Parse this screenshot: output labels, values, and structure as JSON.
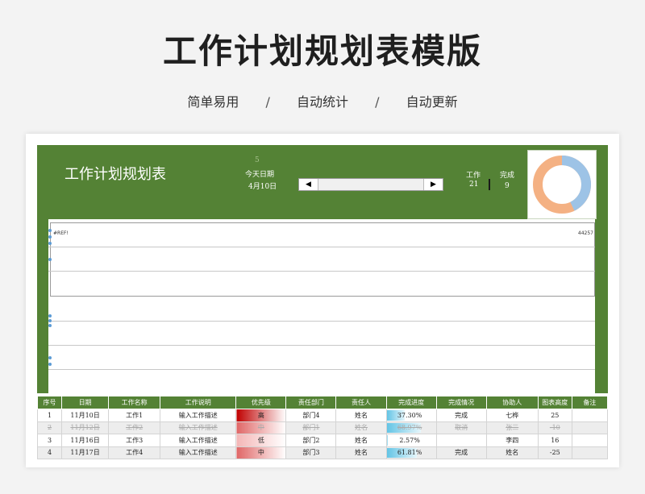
{
  "hero": {
    "title": "工作计划规划表模版",
    "features": [
      "简单易用",
      "自动统计",
      "自动更新"
    ],
    "separator": "/"
  },
  "sheet": {
    "title": "工作计划规划表",
    "small_number": "5",
    "today_label": "今天日期",
    "today_date": "4月10日",
    "stats": {
      "work_label": "工作",
      "work_value": "21",
      "done_label": "完成",
      "done_value": "9"
    },
    "scroll": {
      "left_arrow": "◀",
      "right_arrow": "▶"
    },
    "donut": {
      "completed": 9,
      "total": 21,
      "colors": {
        "done": "#9dc3e6",
        "remaining": "#f4b183"
      }
    },
    "gantt": {
      "ref_text": "#REF!",
      "serial_text": "44257"
    }
  },
  "colors": {
    "accent": "#548235",
    "priority_high": "#c00000",
    "progress_bar": "#63c4e5"
  },
  "table": {
    "headers": [
      "序号",
      "日期",
      "工作名称",
      "工作说明",
      "优先级",
      "责任部门",
      "责任人",
      "完成进度",
      "完成情况",
      "协助人",
      "图表高度",
      "备注"
    ],
    "rows": [
      {
        "no": "1",
        "date": "11月10日",
        "name": "工作1",
        "desc": "输入工作描述",
        "priority": "高",
        "dept": "部门4",
        "owner": "姓名",
        "progress": "37.30%",
        "progress_value": 0.373,
        "status": "完成",
        "helper": "七桦",
        "height": "25",
        "note": "",
        "struck": false,
        "prio_color": "#c00000"
      },
      {
        "no": "2",
        "date": "11月12日",
        "name": "工作2",
        "desc": "输入工作描述",
        "priority": "中",
        "dept": "部门1",
        "owner": "姓名",
        "progress": "68.97%",
        "progress_value": 0.6897,
        "status": "取消",
        "helper": "张三",
        "height": "-10",
        "note": "",
        "struck": true,
        "prio_color": "#e06666"
      },
      {
        "no": "3",
        "date": "11月16日",
        "name": "工作3",
        "desc": "输入工作描述",
        "priority": "低",
        "dept": "部门2",
        "owner": "姓名",
        "progress": "2.57%",
        "progress_value": 0.0257,
        "status": "",
        "helper": "李四",
        "height": "16",
        "note": "",
        "struck": false,
        "prio_color": "#f4b6b6"
      },
      {
        "no": "4",
        "date": "11月17日",
        "name": "工作4",
        "desc": "输入工作描述",
        "priority": "中",
        "dept": "部门3",
        "owner": "姓名",
        "progress": "61.81%",
        "progress_value": 0.6181,
        "status": "完成",
        "helper": "姓名",
        "height": "-25",
        "note": "",
        "struck": false,
        "prio_color": "#e06666"
      }
    ]
  }
}
